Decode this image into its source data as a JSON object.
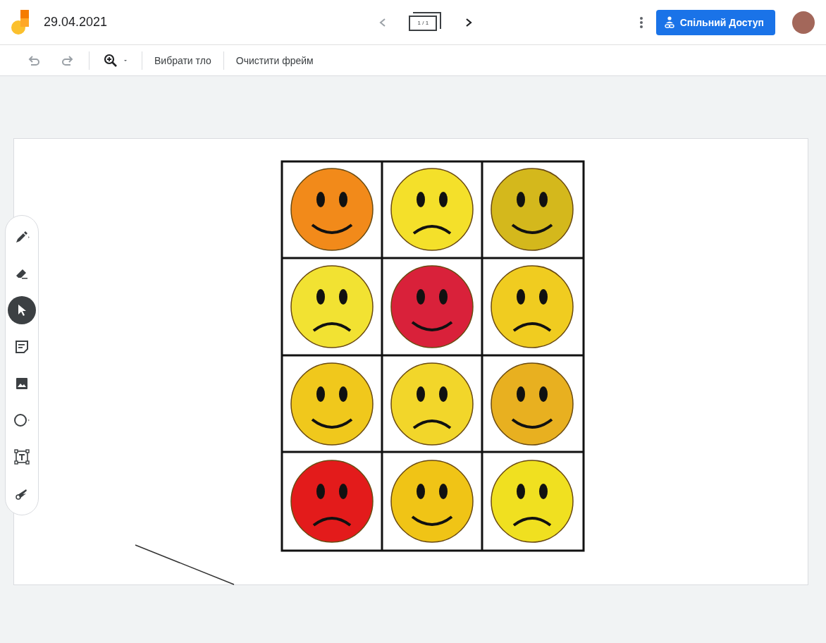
{
  "header": {
    "title": "29.04.2021",
    "frame_counter": "1 / 1",
    "share_button": "Спільний Доступ"
  },
  "toolbar": {
    "actions": [
      "Вибрати тло",
      "Очистити фрейм"
    ]
  },
  "tools": [
    {
      "kind": "pen",
      "selected": false
    },
    {
      "kind": "eraser",
      "selected": false
    },
    {
      "kind": "select",
      "selected": true
    },
    {
      "kind": "note",
      "selected": false
    },
    {
      "kind": "image",
      "selected": false
    },
    {
      "kind": "circle",
      "selected": false
    },
    {
      "kind": "textbox",
      "selected": false
    },
    {
      "kind": "laser",
      "selected": false
    }
  ]
}
